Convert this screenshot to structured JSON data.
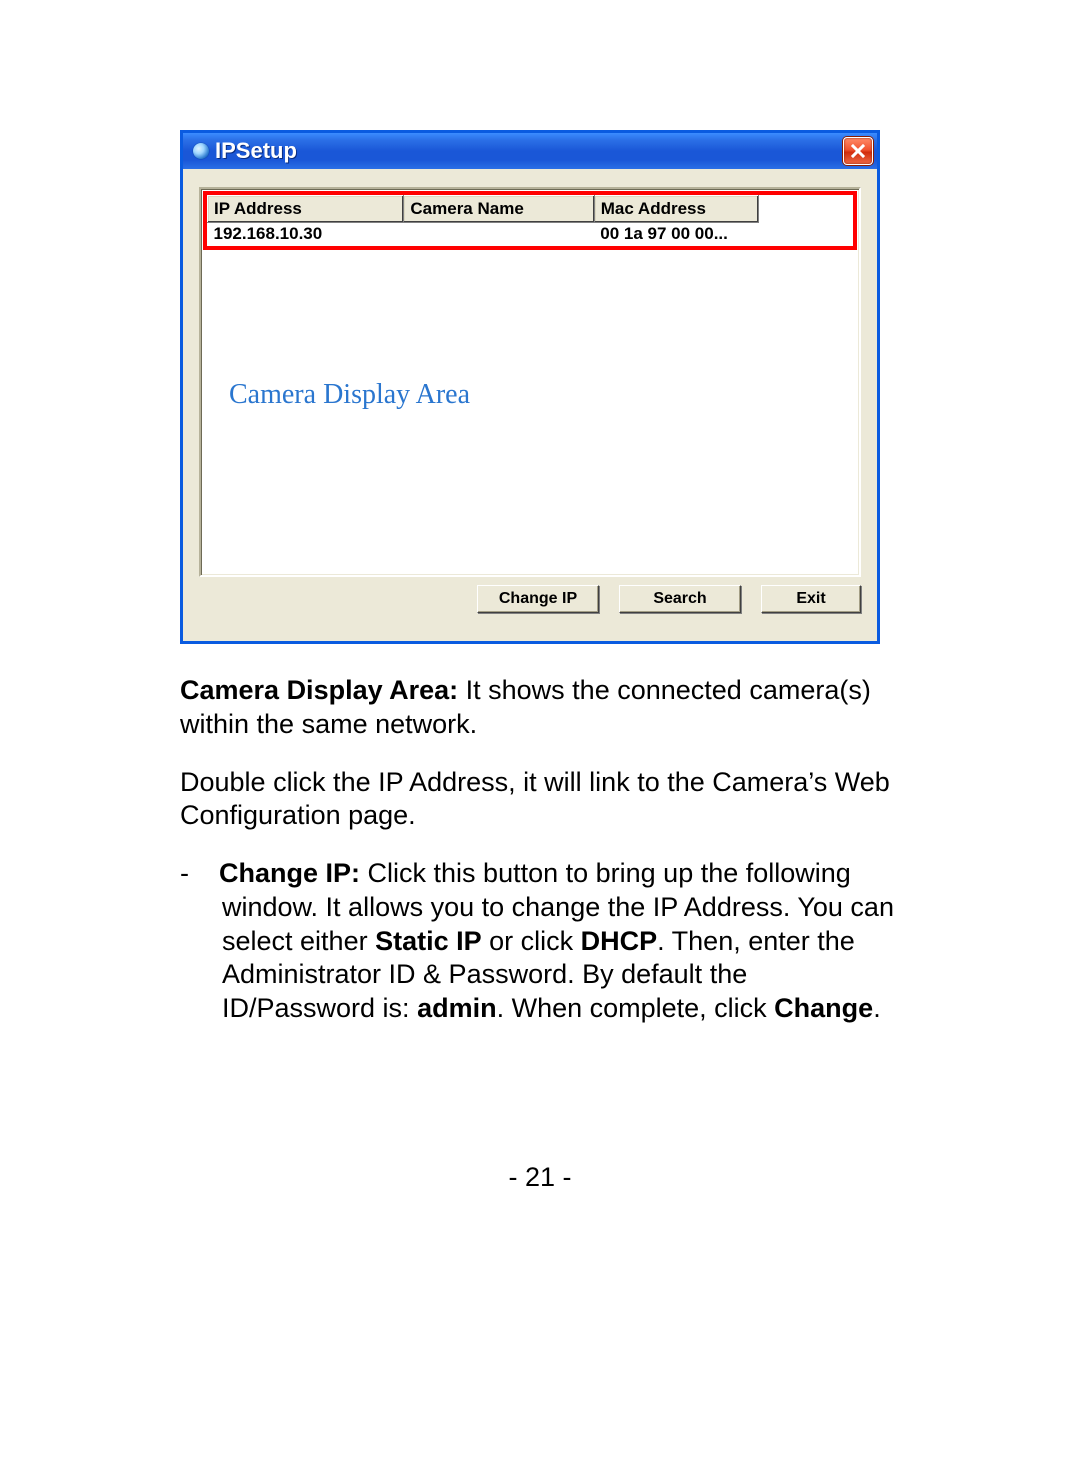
{
  "window": {
    "title": "IPSetup"
  },
  "table": {
    "headers": {
      "ip": "IP Address",
      "name": "Camera Name",
      "mac": "Mac Address"
    },
    "rows": [
      {
        "ip": "192.168.10.30",
        "name": "",
        "mac": "00 1a 97 00 00..."
      }
    ]
  },
  "annotation": "Camera Display Area",
  "buttons": {
    "change_ip": "Change IP",
    "search": "Search",
    "exit": "Exit"
  },
  "doc": {
    "p1_bold": "Camera Display Area:",
    "p1_rest": "  It shows the connected camera(s) within the same network.",
    "p2": "Double click the IP Address, it will link to the Camera’s Web Configuration page.",
    "p3_dash": "-",
    "p3_bold": "Change IP:",
    "p3_a": "  Click this button to bring up the following window.  It allows you to change the IP Address.  You can select either ",
    "p3_staticip": "Static IP",
    "p3_b": " or click ",
    "p3_dhcp": "DHCP",
    "p3_c": ".  Then, enter the Administrator ID & Password.  By default the ID/Password is: ",
    "p3_admin": "admin",
    "p3_d": ".  When complete, click ",
    "p3_change": "Change",
    "p3_e": "."
  },
  "page_number": "- 21 -"
}
